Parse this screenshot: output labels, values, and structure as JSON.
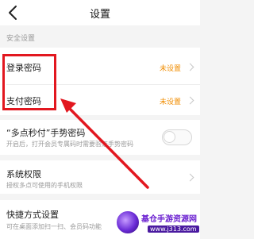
{
  "header": {
    "title": "设置",
    "back_icon": "chevron-left-icon"
  },
  "security_section": {
    "label": "安全设置",
    "login_password": {
      "label": "登录密码",
      "value": "未设置"
    },
    "pay_password": {
      "label": "支付密码",
      "value": "未设置"
    },
    "gesture_password": {
      "label": "“多点秒付”手势密码",
      "description": "开启后，打开会员专属码时需要验证手势密码",
      "enabled": false
    }
  },
  "system_permissions": {
    "label": "系统权限",
    "description": "授权多点可使用的手机权限"
  },
  "shortcut_settings": {
    "label": "快捷方式设置",
    "description": "可在桌面添加扫一扫、会员码功能"
  },
  "annotation": {
    "highlight_color": "#e2171f"
  },
  "watermark": {
    "title": "基仓手游资源网",
    "url": "www.j313.com"
  },
  "colors": {
    "accent_value": "#f08c00",
    "background": "#f4f4f4"
  }
}
